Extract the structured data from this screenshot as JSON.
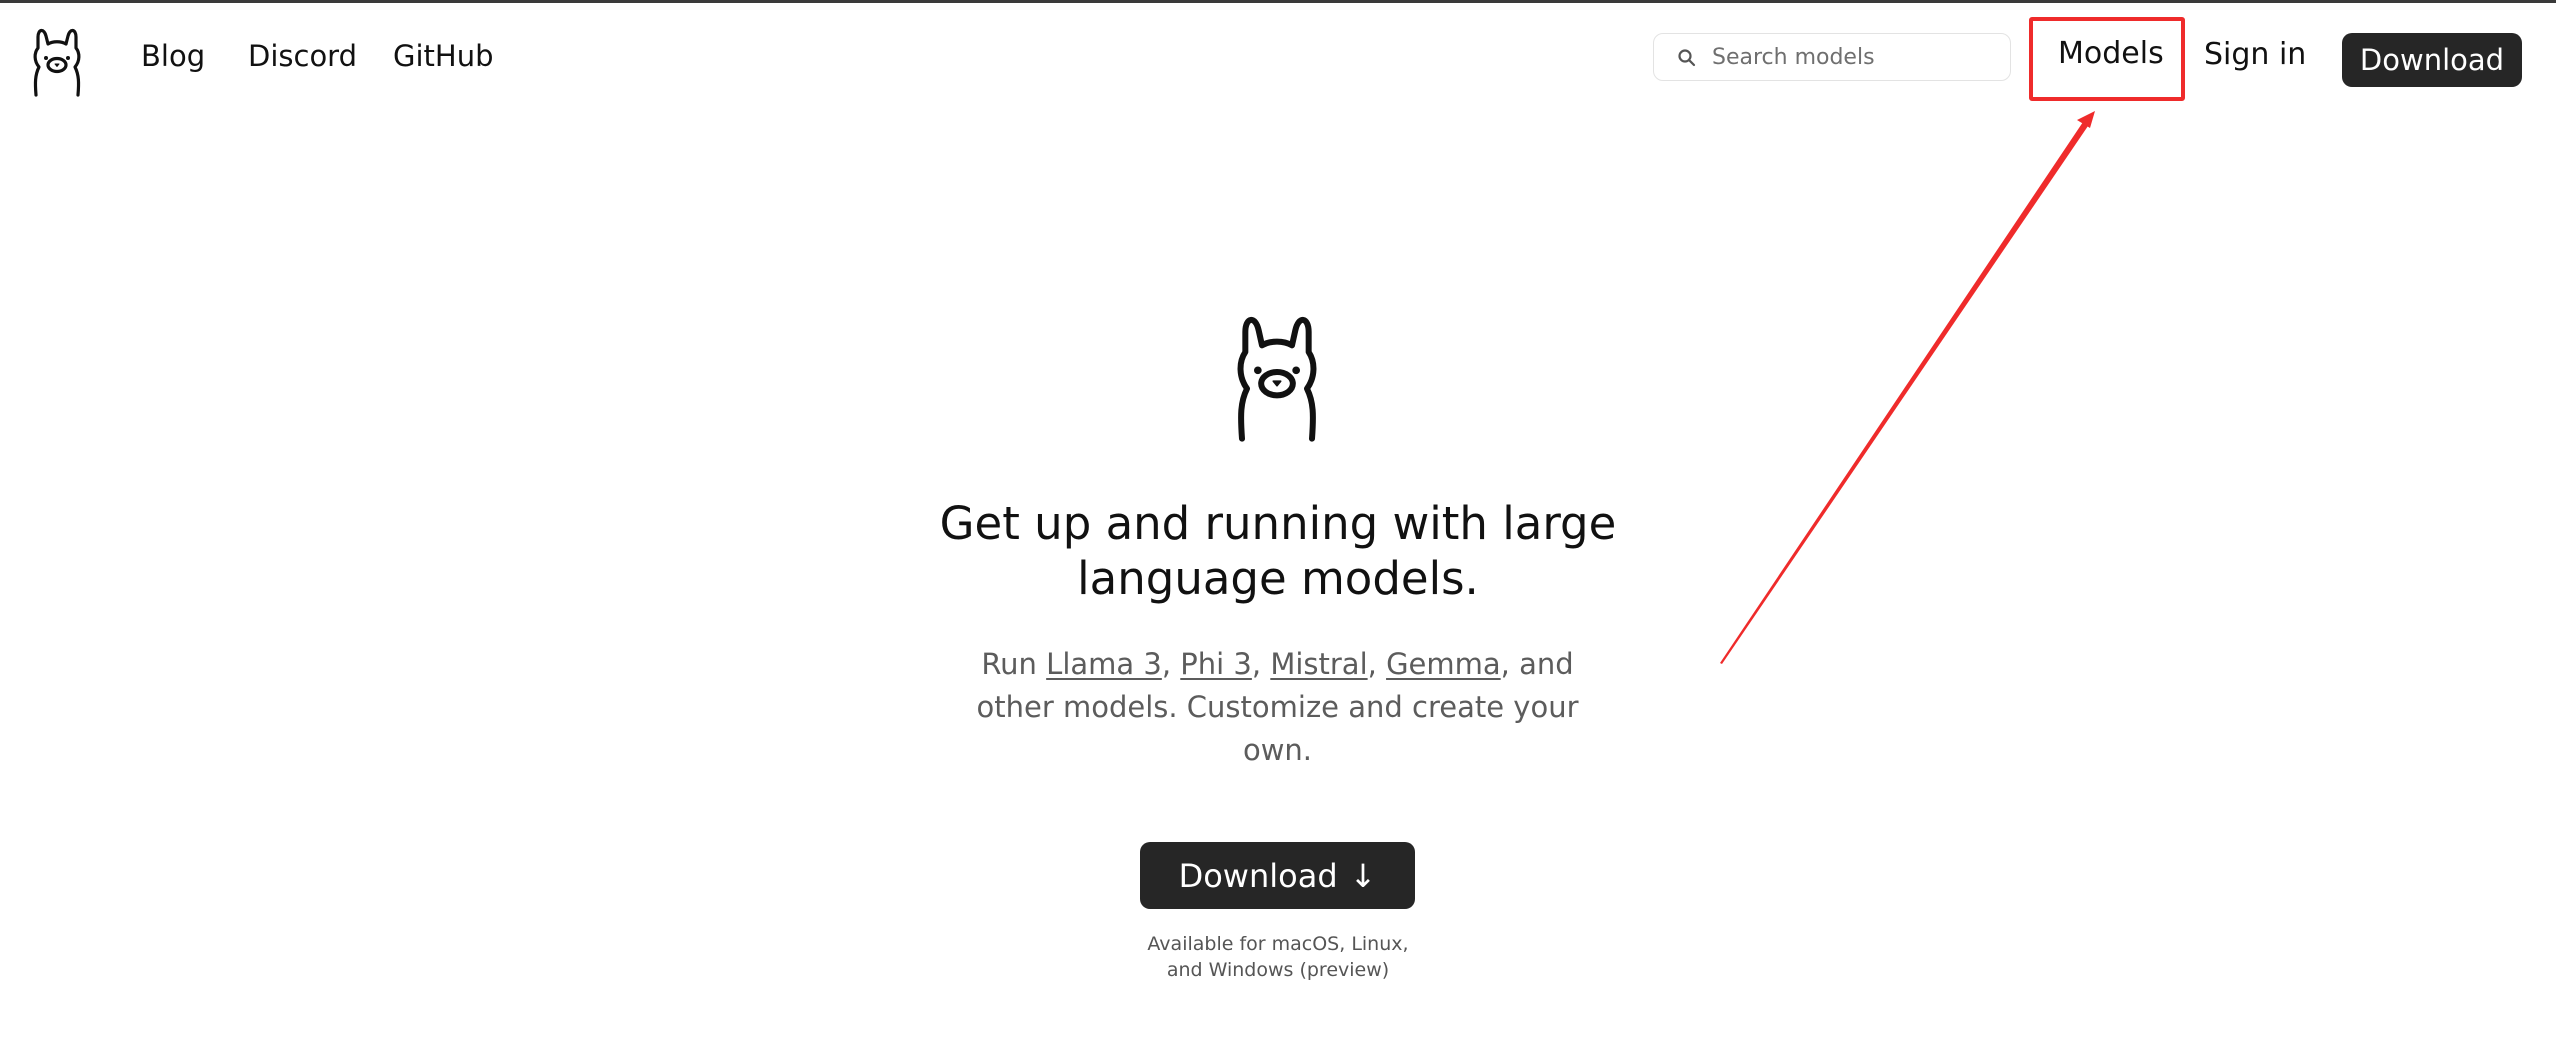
{
  "header": {
    "nav": [
      {
        "label": "Blog"
      },
      {
        "label": "Discord"
      },
      {
        "label": "GitHub"
      }
    ],
    "search": {
      "placeholder": "Search models"
    },
    "models_label": "Models",
    "signin_label": "Sign in",
    "download_label": "Download"
  },
  "hero": {
    "title": "Get up and running with large language models.",
    "subtitle": {
      "prefix": "Run",
      "models": [
        "Llama 3",
        "Phi 3",
        "Mistral",
        "Gemma"
      ],
      "sep": ",",
      "suffix": ", and other models. Customize and create your own."
    },
    "download_label": "Download",
    "download_arrow": "↓",
    "availability_line1": "Available for macOS, Linux,",
    "availability_line2": "and Windows (preview)"
  },
  "annotation": {
    "color": "#ef2b2b"
  },
  "colors": {
    "button_bg": "#262626",
    "text": "#111111",
    "muted": "#5c5c5c"
  },
  "icons": [
    "llama-logo-icon",
    "search-icon",
    "down-arrow-icon"
  ]
}
